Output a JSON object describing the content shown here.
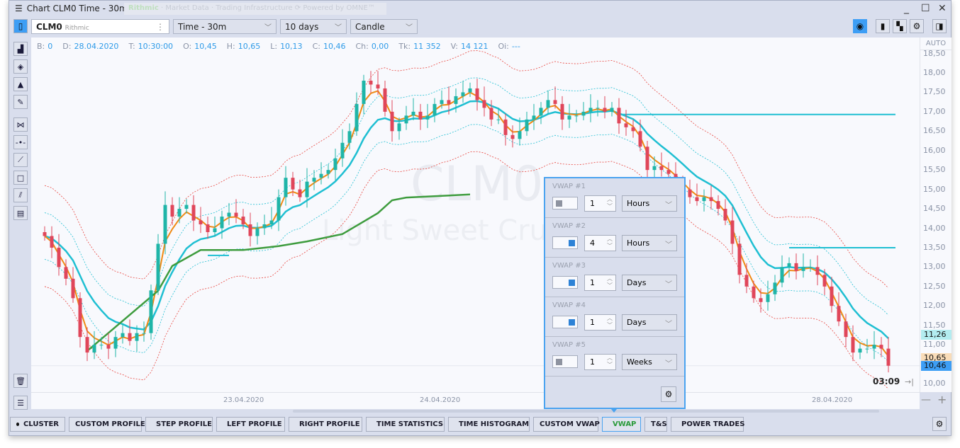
{
  "window": {
    "title": "Chart CLM0 Time - 30m",
    "brand": "Rithmic",
    "brand_tagline": "· Market Data · Trading Infrastructure",
    "omne": "Powered by OMNE™"
  },
  "toolbar": {
    "symbol": "CLM0",
    "provider": "Rithmic",
    "timeframe": "Time - 30m",
    "period": "10 days",
    "chart_type": "Candle"
  },
  "info_bar": [
    {
      "k": "B:",
      "v": "0"
    },
    {
      "k": "D:",
      "v": "28.04.2020"
    },
    {
      "k": "T:",
      "v": "10:30:00"
    },
    {
      "k": "O:",
      "v": "10,45"
    },
    {
      "k": "H:",
      "v": "10,65"
    },
    {
      "k": "L:",
      "v": "10,13"
    },
    {
      "k": "C:",
      "v": "10,46"
    },
    {
      "k": "Ch:",
      "v": "0,00"
    },
    {
      "k": "Tk:",
      "v": "11 352"
    },
    {
      "k": "V:",
      "v": "14 121"
    },
    {
      "k": "Oi:",
      "v": "---"
    }
  ],
  "price_axis": {
    "mode": "AUTO",
    "ticks": [
      "18,50",
      "18,00",
      "17,50",
      "17,00",
      "16,50",
      "16,00",
      "15,50",
      "15,00",
      "14,50",
      "14,00",
      "13,50",
      "13,00",
      "12,50",
      "12,00",
      "11,50",
      "11,00",
      "10,50",
      "10,00"
    ],
    "markers": [
      {
        "label": "11,26",
        "value": 11.26,
        "color": "#b3ecf0"
      },
      {
        "label": "10,65",
        "value": 10.65,
        "color": "#f9dcb8"
      },
      {
        "label": "10,46",
        "value": 10.46,
        "color": "#3d9ef5"
      }
    ]
  },
  "timer": "03:09",
  "time_axis": [
    "23.04.2020",
    "24.04.2020",
    "28.04.2020"
  ],
  "watermark": {
    "symbol": "CLM0",
    "name": "Light Sweet Crude"
  },
  "chart_data": {
    "type": "candlestick",
    "ylim": [
      9.8,
      18.55
    ],
    "closes": [
      13.8,
      13.5,
      13.0,
      12.7,
      12.2,
      11.2,
      10.8,
      11.0,
      11.0,
      10.9,
      11.2,
      11.3,
      11.1,
      11.3,
      11.3,
      12.4,
      13.6,
      14.6,
      14.3,
      14.5,
      14.6,
      14.2,
      14.1,
      13.9,
      14.0,
      14.3,
      14.4,
      14.3,
      14.1,
      13.8,
      14.0,
      14.1,
      14.2,
      14.8,
      15.3,
      15.0,
      14.8,
      15.2,
      15.3,
      15.4,
      15.5,
      15.8,
      16.2,
      16.5,
      17.2,
      17.8,
      17.7,
      17.6,
      17.0,
      16.5,
      16.7,
      16.9,
      17.0,
      16.8,
      16.9,
      17.2,
      17.3,
      17.2,
      17.4,
      17.5,
      17.6,
      17.3,
      17.1,
      16.8,
      16.8,
      16.4,
      16.3,
      16.5,
      16.8,
      16.9,
      17.1,
      17.3,
      17.2,
      16.8,
      16.9,
      16.9,
      17.0,
      17.1,
      17.1,
      17.0,
      17.1,
      16.7,
      16.6,
      16.5,
      16.1,
      15.5,
      15.6,
      15.5,
      15.4,
      15.2,
      15.0,
      14.8,
      14.7,
      14.8,
      14.7,
      14.5,
      14.2,
      13.6,
      12.8,
      12.5,
      12.2,
      12.1,
      12.3,
      12.6,
      13.0,
      13.1,
      12.9,
      13.0,
      13.0,
      12.8,
      12.5,
      12.0,
      11.6,
      11.2,
      10.8,
      10.9,
      10.9,
      11.0,
      10.9,
      10.46
    ],
    "green_vwap": [
      [
        6,
        10.84
      ],
      [
        16,
        12.39
      ],
      [
        18,
        13.03
      ],
      [
        22,
        13.44
      ],
      [
        28,
        13.44
      ],
      [
        33,
        13.54
      ],
      [
        37,
        13.66
      ],
      [
        42,
        13.85
      ],
      [
        47,
        14.39
      ],
      [
        49,
        14.72
      ],
      [
        51,
        14.79
      ],
      [
        60,
        14.87
      ]
    ],
    "levels": [
      {
        "value": 16.93,
        "from": 81,
        "to": 120
      },
      {
        "value": 13.5,
        "from": 105,
        "to": 120
      },
      {
        "value": 13.3,
        "from": 23,
        "to": 26
      }
    ],
    "colors": {
      "up": "#1fb5a8",
      "down": "#e0465a",
      "vwap": "#1fbfd2",
      "band_inner": "#1fbfd2",
      "band_outer": "#e8453e",
      "short": "#f08a14",
      "green": "#3e9c3e"
    }
  },
  "vwap_panel": {
    "rows": [
      {
        "label": "VWAP #1",
        "on": false,
        "value": "1",
        "unit": "Hours"
      },
      {
        "label": "VWAP #2",
        "on": true,
        "value": "4",
        "unit": "Hours"
      },
      {
        "label": "VWAP #3",
        "on": true,
        "value": "1",
        "unit": "Days"
      },
      {
        "label": "VWAP #4",
        "on": true,
        "value": "1",
        "unit": "Days"
      },
      {
        "label": "VWAP #5",
        "on": false,
        "value": "1",
        "unit": "Weeks"
      }
    ]
  },
  "bottom_buttons": [
    {
      "label": "CLUSTER",
      "dot": true
    },
    {
      "label": "CUSTOM PROFILE",
      "dot": false
    },
    {
      "label": "STEP PROFILE",
      "dot": true
    },
    {
      "label": "LEFT PROFILE",
      "dot": true
    },
    {
      "label": "RIGHT PROFILE",
      "dot": true
    },
    {
      "label": "TIME STATISTICS",
      "dot": true
    },
    {
      "label": "TIME HISTOGRAM",
      "dot": true
    },
    {
      "label": "CUSTOM VWAP",
      "dot": false
    },
    {
      "label": "VWAP",
      "dot": true,
      "active": true
    },
    {
      "label": "T&S",
      "dot": false
    },
    {
      "label": "POWER TRADES",
      "dot": true
    }
  ]
}
